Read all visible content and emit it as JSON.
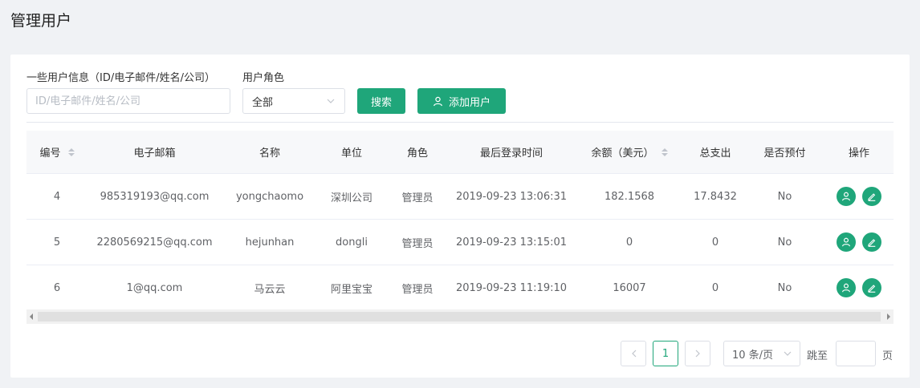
{
  "page": {
    "title": "管理用户"
  },
  "filters": {
    "info_label": "一些用户信息（ID/电子邮件/姓名/公司）",
    "info_placeholder": "ID/电子邮件/姓名/公司",
    "info_value": "",
    "role_label": "用户角色",
    "role_value": "全部",
    "search_button": "搜索",
    "add_button": "添加用户"
  },
  "table": {
    "headers": [
      "编号",
      "电子邮箱",
      "名称",
      "单位",
      "角色",
      "最后登录时间",
      "余额（美元）",
      "总支出",
      "是否预付",
      "操作"
    ],
    "sortable_columns": [
      "编号",
      "余额（美元）"
    ],
    "rows": [
      {
        "id": "4",
        "email": "985319193@qq.com",
        "name": "yongchaomo",
        "unit": "深圳公司",
        "role": "管理员",
        "last_login": "2019-09-23 13:06:31",
        "balance": "182.1568",
        "total_spent": "17.8432",
        "prepaid": "No"
      },
      {
        "id": "5",
        "email": "2280569215@qq.com",
        "name": "hejunhan",
        "unit": "dongli",
        "role": "管理员",
        "last_login": "2019-09-23 13:15:01",
        "balance": "0",
        "total_spent": "0",
        "prepaid": "No"
      },
      {
        "id": "6",
        "email": "1@qq.com",
        "name": "马云云",
        "unit": "阿里宝宝",
        "role": "管理员",
        "last_login": "2019-09-23 11:19:10",
        "balance": "16007",
        "total_spent": "0",
        "prepaid": "No"
      }
    ],
    "row_actions": [
      "user-icon",
      "edit-icon"
    ]
  },
  "pagination": {
    "current_page": "1",
    "page_size": "10 条/页",
    "jump_label": "跳至",
    "page_label": "页",
    "jump_value": ""
  },
  "colors": {
    "accent": "#1fa67a",
    "background": "#f0f2f5",
    "header_bg": "#f7f8fa"
  }
}
